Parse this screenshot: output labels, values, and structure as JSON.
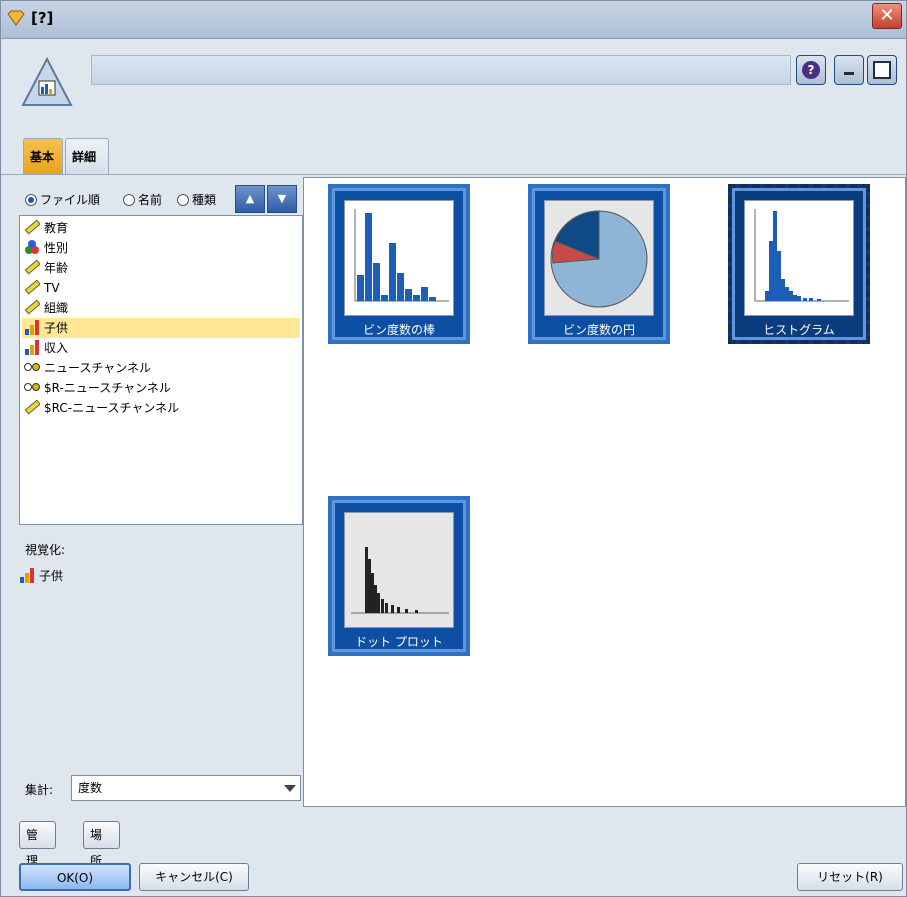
{
  "window": {
    "title": "[?]"
  },
  "tabs": [
    {
      "label": "基本",
      "active": true
    },
    {
      "label": "詳細",
      "active": false
    }
  ],
  "sort": {
    "options": [
      {
        "label": "ファイル順",
        "selected": true
      },
      {
        "label": "名前",
        "selected": false
      },
      {
        "label": "種類",
        "selected": false
      }
    ]
  },
  "fields": [
    {
      "label": "教育",
      "icon": "ruler-continuous-icon",
      "selected": false
    },
    {
      "label": "性別",
      "icon": "flag-nominal-icon",
      "selected": false
    },
    {
      "label": "年齢",
      "icon": "ruler-continuous-icon",
      "selected": false
    },
    {
      "label": "TV",
      "icon": "ruler-continuous-icon",
      "selected": false
    },
    {
      "label": "組織",
      "icon": "ruler-continuous-icon",
      "selected": false
    },
    {
      "label": "子供",
      "icon": "ordinal-bars-icon",
      "selected": true
    },
    {
      "label": "収入",
      "icon": "ordinal-bars-icon",
      "selected": false
    },
    {
      "label": "ニュースチャンネル",
      "icon": "flag-icon",
      "selected": false
    },
    {
      "label": "$R-ニュースチャンネル",
      "icon": "flag-icon",
      "selected": false
    },
    {
      "label": "$RC-ニュースチャンネル",
      "icon": "ruler-continuous-icon",
      "selected": false
    }
  ],
  "visualization": {
    "label": "視覚化:",
    "field": "子供"
  },
  "aggregate": {
    "label": "集計:",
    "value": "度数"
  },
  "gallery": [
    {
      "caption": "ビン度数の棒",
      "selected": false
    },
    {
      "caption": "ビン度数の円",
      "selected": false
    },
    {
      "caption": "ヒストグラム",
      "selected": true
    },
    {
      "caption": "ドット プロット",
      "selected": false
    }
  ],
  "buttons": {
    "manage": "管理...",
    "location": "場所...",
    "ok": "OK(O)",
    "cancel": "キャンセル(C)",
    "reset": "リセット(R)"
  },
  "colors": {
    "accent": "#1c56b0",
    "tab_active": "#f6c14e",
    "selected_row": "#ffe796"
  }
}
